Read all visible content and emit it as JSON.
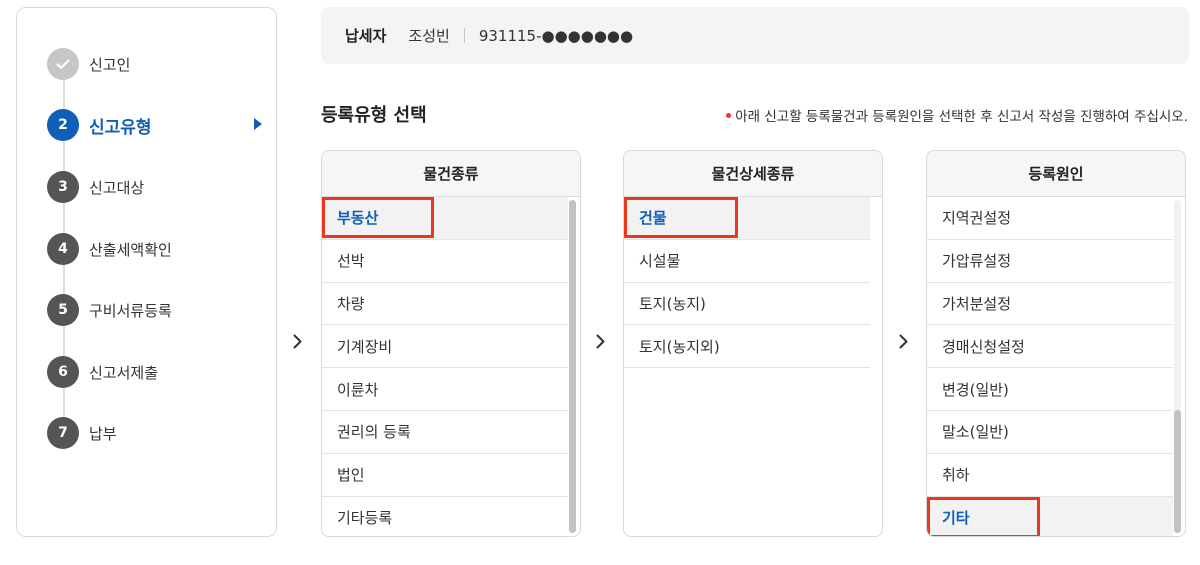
{
  "steps": [
    {
      "num": "✓",
      "label": "신고인",
      "state": "done"
    },
    {
      "num": "2",
      "label": "신고유형",
      "state": "active"
    },
    {
      "num": "3",
      "label": "신고대상",
      "state": "todo"
    },
    {
      "num": "4",
      "label": "산출세액확인",
      "state": "todo"
    },
    {
      "num": "5",
      "label": "구비서류등록",
      "state": "todo"
    },
    {
      "num": "6",
      "label": "신고서제출",
      "state": "todo"
    },
    {
      "num": "7",
      "label": "납부",
      "state": "todo"
    }
  ],
  "taxpayer": {
    "label": "납세자",
    "name": "조성빈",
    "id": "931115-●●●●●●●"
  },
  "section": {
    "title": "등록유형 선택",
    "notice": "아래 신고할 등록물건과 등록원인을 선택한 후 신고서 작성을 진행하여 주십시오."
  },
  "columns": {
    "property_type": {
      "header": "물건종류",
      "items": [
        "부동산",
        "선박",
        "차량",
        "기계장비",
        "이륜차",
        "권리의 등록",
        "법인",
        "기타등록"
      ],
      "selected": "부동산"
    },
    "property_detail": {
      "header": "물건상세종류",
      "items": [
        "건물",
        "시설물",
        "토지(농지)",
        "토지(농지외)"
      ],
      "selected": "건물"
    },
    "registration_cause": {
      "header": "등록원인",
      "items": [
        "지역권설정",
        "가압류설정",
        "가처분설정",
        "경매신청설정",
        "변경(일반)",
        "말소(일반)",
        "취하",
        "기타"
      ],
      "selected": "기타"
    }
  },
  "colors": {
    "accent": "#0f5eb8",
    "highlight_border": "#e8391e",
    "notice_dot": "#e83c1e"
  }
}
